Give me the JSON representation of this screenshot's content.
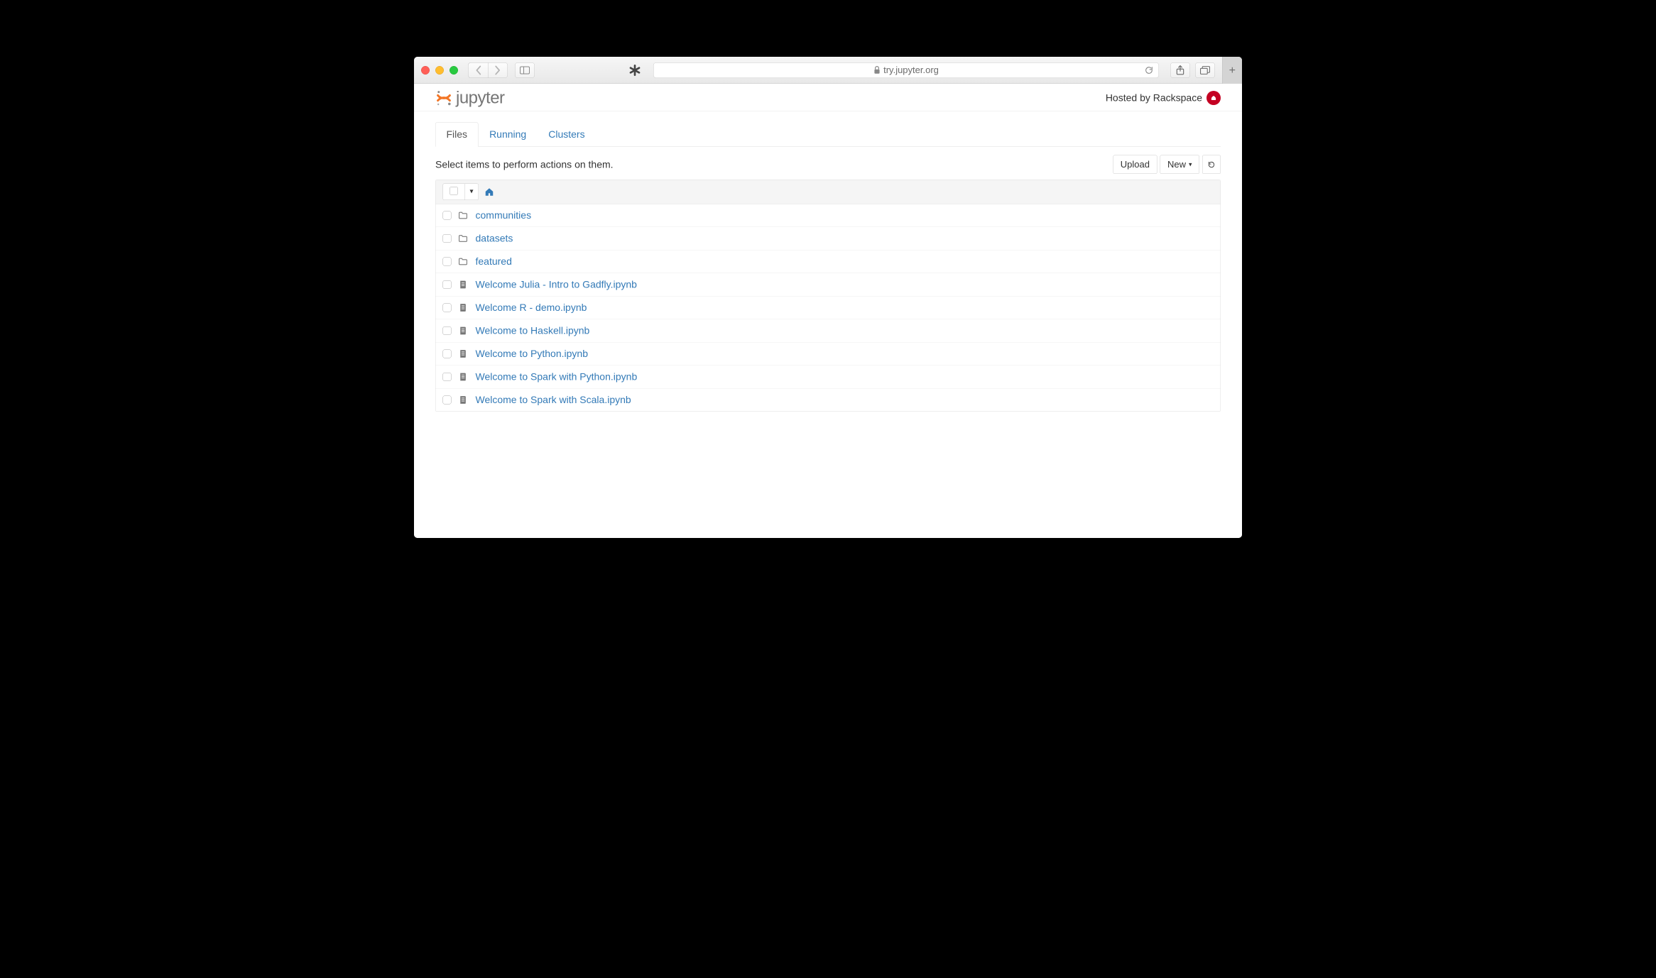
{
  "browser": {
    "url": "try.jupyter.org"
  },
  "header": {
    "logo_text": "jupyter",
    "hosted_by": "Hosted by Rackspace"
  },
  "tabs": [
    {
      "label": "Files",
      "active": true
    },
    {
      "label": "Running",
      "active": false
    },
    {
      "label": "Clusters",
      "active": false
    }
  ],
  "toolbar": {
    "info_text": "Select items to perform actions on them.",
    "upload_label": "Upload",
    "new_label": "New"
  },
  "items": [
    {
      "type": "folder",
      "name": "communities"
    },
    {
      "type": "folder",
      "name": "datasets"
    },
    {
      "type": "folder",
      "name": "featured"
    },
    {
      "type": "notebook",
      "name": "Welcome Julia - Intro to Gadfly.ipynb"
    },
    {
      "type": "notebook",
      "name": "Welcome R - demo.ipynb"
    },
    {
      "type": "notebook",
      "name": "Welcome to Haskell.ipynb"
    },
    {
      "type": "notebook",
      "name": "Welcome to Python.ipynb"
    },
    {
      "type": "notebook",
      "name": "Welcome to Spark with Python.ipynb"
    },
    {
      "type": "notebook",
      "name": "Welcome to Spark with Scala.ipynb"
    }
  ]
}
